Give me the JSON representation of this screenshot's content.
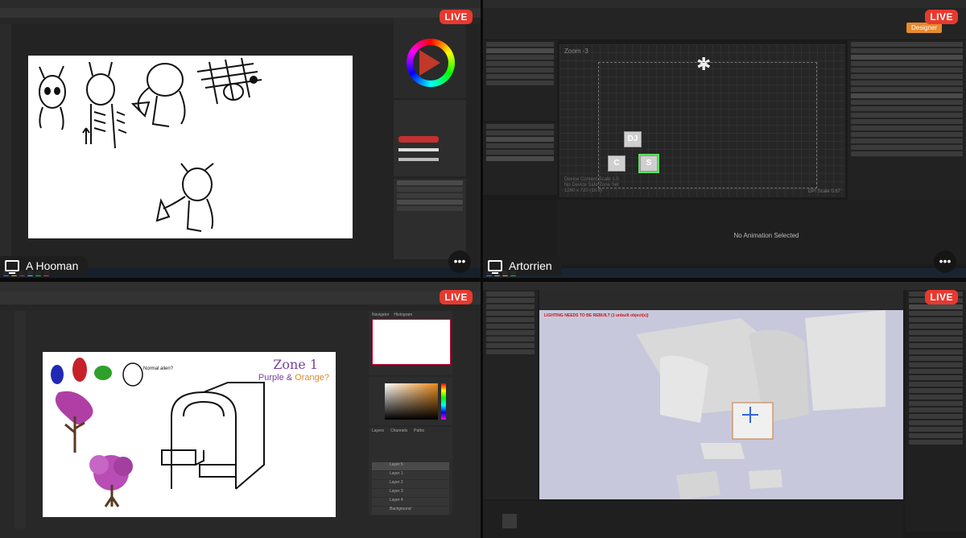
{
  "tiles": {
    "top_left": {
      "user_name": "A Hooman",
      "live_label": "LIVE"
    },
    "top_right": {
      "user_name": "Artorrien",
      "live_label": "LIVE",
      "designer_label": "Designer",
      "zoom_text": "Zoom -3",
      "buttons": {
        "dj": "DJ",
        "c": "C",
        "s": "S"
      },
      "animation_empty_text": "No Animation Selected",
      "device_info": [
        "Device Content Scale 1.0",
        "No Device Safe Zone Set",
        "1280 x 720 (16:9)"
      ],
      "dpi_text": "DPI Scale 0.67"
    },
    "bottom_left": {
      "live_label": "LIVE",
      "zone_title": "Zone 1",
      "zone_subtitle_purple": "Purple &",
      "zone_subtitle_orange": "Orange?",
      "note_text": "Normal alien?",
      "layers": [
        "Layer 5",
        "Layer 1",
        "Layer 2",
        "Layer 3",
        "Layer 4",
        "Background"
      ],
      "panel_tabs": [
        "Layers",
        "Channels",
        "Paths"
      ],
      "nav_tabs": [
        "Navigator",
        "Histogram"
      ]
    },
    "bottom_right": {
      "live_label": "LIVE",
      "warning_text": "LIGHTING NEEDS TO BE REBUILT (1 unbuilt object(s))"
    }
  },
  "colors": {
    "live_red": "#e8392f",
    "ue_orange": "#e7892d",
    "selection_green": "#5ce05c",
    "zone_purple": "#7b3fa0",
    "zone_orange": "#d98a2b"
  },
  "icons": [
    "monitor-icon",
    "more-icon",
    "color-wheel-icon",
    "spinner-icon"
  ]
}
